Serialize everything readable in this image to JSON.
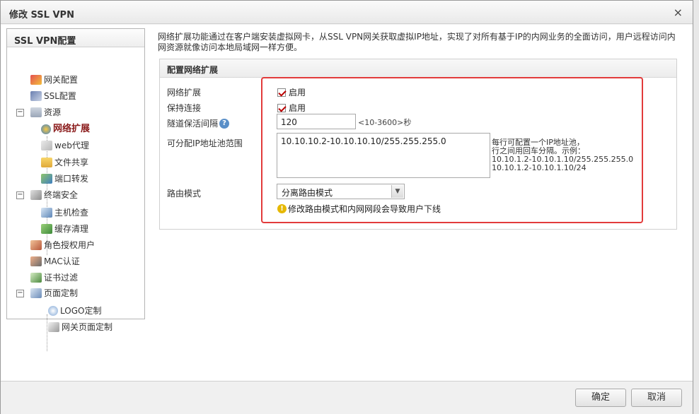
{
  "dialog": {
    "title": "修改 SSL VPN",
    "close_symbol": "×"
  },
  "sidebar": {
    "header": "SSL VPN配置",
    "items": [
      {
        "label": "网关配置"
      },
      {
        "label": "SSL配置"
      },
      {
        "label": "资源",
        "toggle": "−"
      },
      {
        "label": "网络扩展"
      },
      {
        "label": "web代理"
      },
      {
        "label": "文件共享"
      },
      {
        "label": "端口转发"
      },
      {
        "label": "终端安全",
        "toggle": "−"
      },
      {
        "label": "主机检查"
      },
      {
        "label": "缓存清理"
      },
      {
        "label": "角色授权用户"
      },
      {
        "label": "MAC认证"
      },
      {
        "label": "证书过滤"
      },
      {
        "label": "页面定制",
        "toggle": "−"
      },
      {
        "label": "LOGO定制"
      },
      {
        "label": "网关页面定制"
      }
    ]
  },
  "main": {
    "description": "网络扩展功能通过在客户端安装虚拟网卡，从SSL VPN网关获取虚拟IP地址，实现了对所有基于IP的内网业务的全面访问，用户远程访问内网资源就像访问本地局域网一样方便。",
    "section_title": "配置网络扩展",
    "fields": {
      "net_ext_label": "网络扩展",
      "net_ext_checkbox": "启用",
      "keepalive_label": "保持连接",
      "keepalive_checkbox": "启用",
      "tunnel_interval_label": "隧道保活间隔",
      "tunnel_interval_value": "120",
      "tunnel_interval_hint": "<10-3600>秒",
      "ip_pool_label": "可分配IP地址池范围",
      "ip_pool_value": "10.10.10.2-10.10.10.10/255.255.255.0",
      "ip_pool_hint_1": "每行可配置一个IP地址池，",
      "ip_pool_hint_2": "行之间用回车分隔。示例：",
      "ip_pool_hint_3": "10.10.1.2-10.10.1.10/255.255.255.0",
      "ip_pool_hint_4": "10.10.1.2-10.10.1.10/24",
      "route_mode_label": "路由模式",
      "route_mode_value": "分离路由模式",
      "route_warning": "修改路由模式和内网网段会导致用户下线"
    },
    "help_symbol": "?",
    "warn_symbol": "!"
  },
  "footer": {
    "ok_label": "确定",
    "cancel_label": "取消"
  },
  "colors": {
    "highlight_border": "#e23b3b",
    "active_item": "#8a1a1a"
  }
}
